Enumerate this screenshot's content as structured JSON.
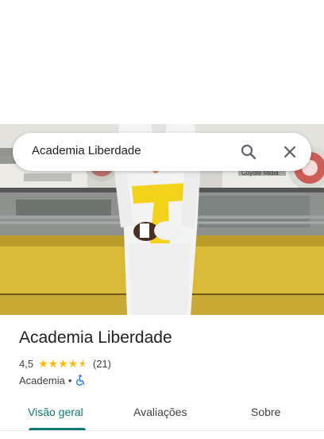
{
  "search": {
    "query": "Academia Liberdade"
  },
  "place": {
    "name": "Academia Liberdade",
    "rating": "4,5",
    "stars": 4.5,
    "reviews_count": "(21)",
    "category": "Academia",
    "separator": "•"
  },
  "tabs": [
    {
      "label": "Visão geral",
      "active": true
    },
    {
      "label": "Avaliações",
      "active": false
    },
    {
      "label": "Sobre",
      "active": false
    }
  ],
  "photo": {
    "banner_text_1": "Coyote Midia"
  },
  "colors": {
    "accent": "#0b7a75",
    "star": "#fbbc04",
    "belt": "#f2d21b",
    "floor": "#d9b938",
    "gi": "#f4f4f4"
  }
}
